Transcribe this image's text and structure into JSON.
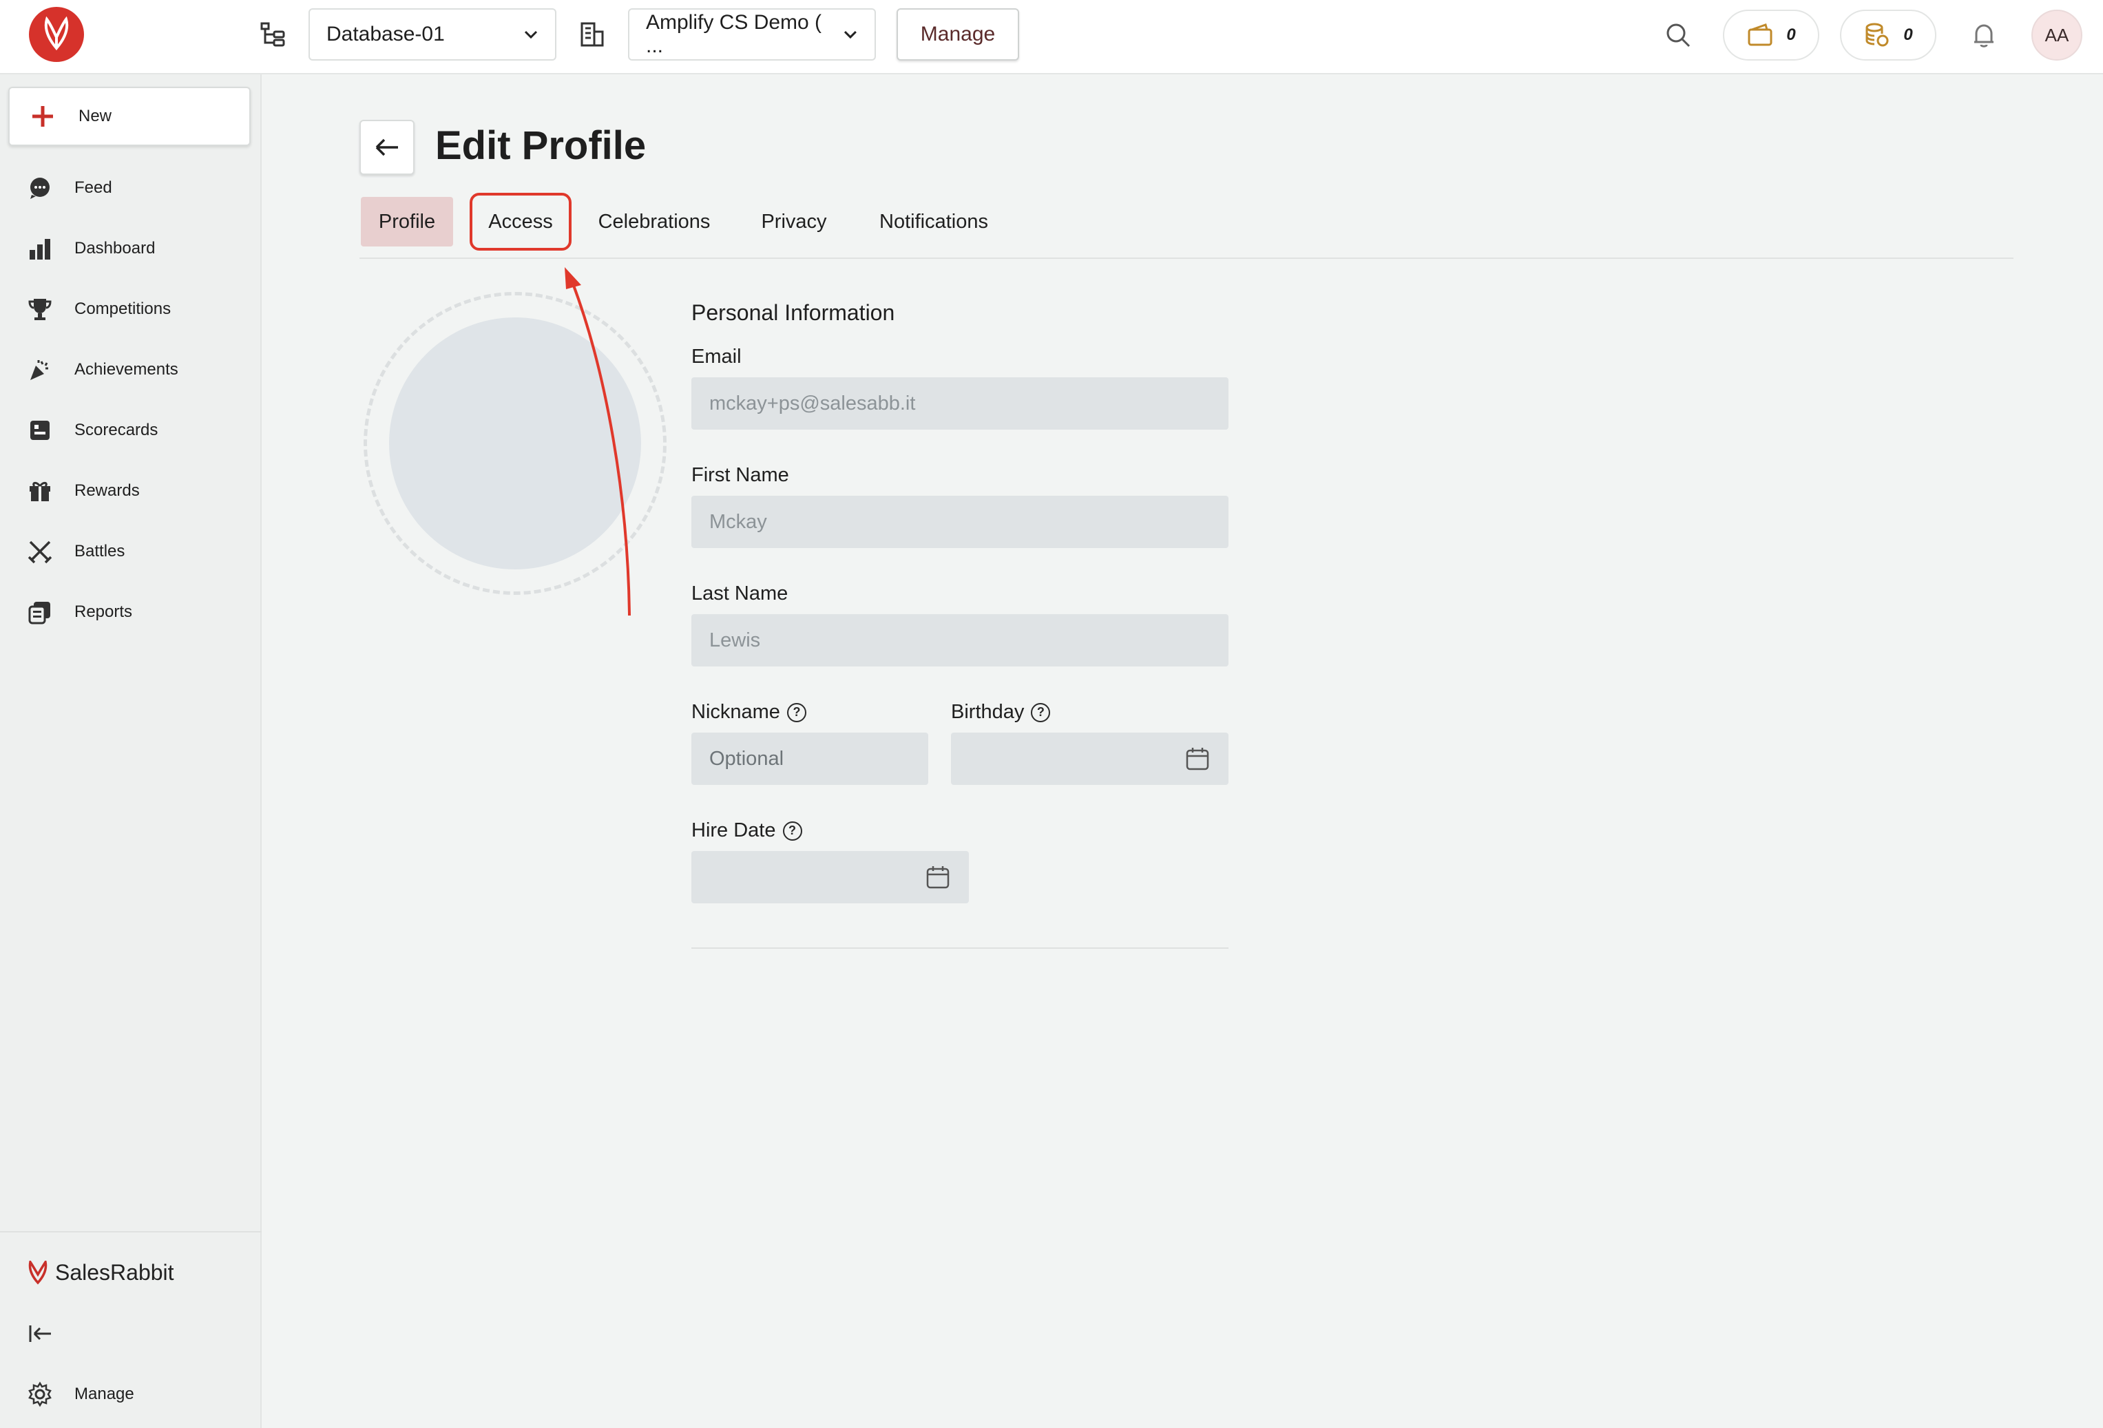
{
  "topbar": {
    "database_select": "Database-01",
    "org_select": "Amplify CS Demo ( ...",
    "manage_label": "Manage",
    "wallet_count": "0",
    "coins_count": "0",
    "avatar_initials": "AA"
  },
  "sidebar": {
    "new_label": "New",
    "items": [
      {
        "label": "Feed",
        "icon": "chat-bubble-icon"
      },
      {
        "label": "Dashboard",
        "icon": "bar-chart-icon"
      },
      {
        "label": "Competitions",
        "icon": "trophy-icon"
      },
      {
        "label": "Achievements",
        "icon": "party-popper-icon"
      },
      {
        "label": "Scorecards",
        "icon": "scorecard-icon"
      },
      {
        "label": "Rewards",
        "icon": "gift-icon"
      },
      {
        "label": "Battles",
        "icon": "crossed-swords-icon"
      },
      {
        "label": "Reports",
        "icon": "reports-icon"
      }
    ],
    "brand_name": "SalesRabbit",
    "manage_label": "Manage"
  },
  "page": {
    "title": "Edit Profile",
    "tabs": [
      {
        "label": "Profile",
        "active": true
      },
      {
        "label": "Access",
        "active": false
      },
      {
        "label": "Celebrations",
        "active": false
      },
      {
        "label": "Privacy",
        "active": false
      },
      {
        "label": "Notifications",
        "active": false
      }
    ]
  },
  "form": {
    "section_title": "Personal Information",
    "email_label": "Email",
    "email_value": "mckay+ps@salesabb.it",
    "first_name_label": "First Name",
    "first_name_value": "Mckay",
    "last_name_label": "Last Name",
    "last_name_value": "Lewis",
    "nickname_label": "Nickname",
    "nickname_placeholder": "Optional",
    "birthday_label": "Birthday",
    "birthday_value": "",
    "hire_date_label": "Hire Date",
    "hire_date_value": ""
  },
  "colors": {
    "brand": "#d6322b",
    "active_tab": "#e8cfcf",
    "annotation": "#e0382b"
  }
}
